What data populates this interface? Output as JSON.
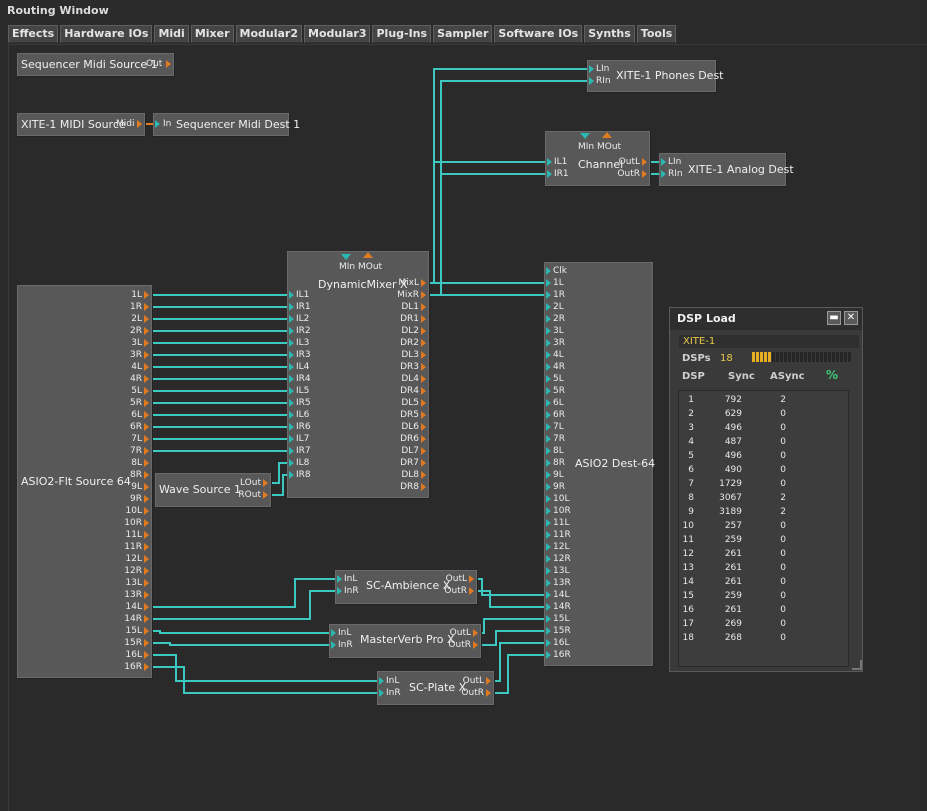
{
  "window": {
    "title": "Routing Window"
  },
  "tabs": [
    "Effects",
    "Hardware IOs",
    "Midi",
    "Mixer",
    "Modular2",
    "Modular3",
    "Plug-Ins",
    "Sampler",
    "Software IOs",
    "Synths",
    "Tools"
  ],
  "modules": {
    "seq_midi_source": {
      "name": "Sequencer Midi Source 1",
      "out": "Out"
    },
    "xite_midi_source": {
      "name": "XITE-1 MIDI Source",
      "out": "Midi"
    },
    "seq_midi_dest": {
      "name": "Sequencer Midi Dest 1",
      "in": "In"
    },
    "phones": {
      "name": "XITE-1 Phones Dest",
      "inputs": [
        "LIn",
        "RIn"
      ]
    },
    "channel": {
      "name": "Channel",
      "top": "MIn MOut",
      "inputs": [
        "IL1",
        "IR1"
      ],
      "outputs": [
        "OutL",
        "OutR"
      ]
    },
    "analog": {
      "name": "XITE-1 Analog Dest",
      "inputs": [
        "LIn",
        "RIn"
      ]
    },
    "dynamicmixer": {
      "name": "DynamicMixer X",
      "top": "MIn MOut",
      "inputs": [
        "IL1",
        "IR1",
        "IL2",
        "IR2",
        "IL3",
        "IR3",
        "IL4",
        "IR4",
        "IL5",
        "IR5",
        "IL6",
        "IR6",
        "IL7",
        "IR7",
        "IL8",
        "IR8"
      ],
      "outputs": [
        "MixL",
        "MixR",
        "DL1",
        "DR1",
        "DL2",
        "DR2",
        "DL3",
        "DR3",
        "DL4",
        "DR4",
        "DL5",
        "DR5",
        "DL6",
        "DR6",
        "DL7",
        "DR7",
        "DL8",
        "DR8"
      ]
    },
    "asio_src": {
      "name": "ASIO2-Flt Source 64",
      "outputs": [
        "1L",
        "1R",
        "2L",
        "2R",
        "3L",
        "3R",
        "4L",
        "4R",
        "5L",
        "5R",
        "6L",
        "6R",
        "7L",
        "7R",
        "8L",
        "8R",
        "9L",
        "9R",
        "10L",
        "10R",
        "11L",
        "11R",
        "12L",
        "12R",
        "13L",
        "13R",
        "14L",
        "14R",
        "15L",
        "15R",
        "16L",
        "16R"
      ]
    },
    "asio_dest": {
      "name": "ASIO2 Dest-64",
      "inputs": [
        "Clk",
        "1L",
        "1R",
        "2L",
        "2R",
        "3L",
        "3R",
        "4L",
        "4R",
        "5L",
        "5R",
        "6L",
        "6R",
        "7L",
        "7R",
        "8L",
        "8R",
        "9L",
        "9R",
        "10L",
        "10R",
        "11L",
        "11R",
        "12L",
        "12R",
        "13L",
        "13R",
        "14L",
        "14R",
        "15L",
        "15R",
        "16L",
        "16R"
      ]
    },
    "wave": {
      "name": "Wave Source 1",
      "outputs": [
        "LOut",
        "ROut"
      ]
    },
    "ambience": {
      "name": "SC-Ambience X",
      "inputs": [
        "InL",
        "InR"
      ],
      "outputs": [
        "OutL",
        "OutR"
      ]
    },
    "masterverb": {
      "name": "MasterVerb Pro X",
      "inputs": [
        "InL",
        "InR"
      ],
      "outputs": [
        "OutL",
        "OutR"
      ]
    },
    "plate": {
      "name": "SC-Plate X",
      "inputs": [
        "InL",
        "InR"
      ],
      "outputs": [
        "OutL",
        "OutR"
      ]
    }
  },
  "dsp": {
    "title": "DSP Load",
    "device": "XITE-1",
    "dsps_label": "DSPs",
    "dsps_value": "18",
    "cols": [
      "DSP",
      "Sync",
      "ASync"
    ],
    "meter_fill": 0.2,
    "rows": [
      [
        "1",
        "792",
        "2"
      ],
      [
        "2",
        "629",
        "0"
      ],
      [
        "3",
        "496",
        "0"
      ],
      [
        "4",
        "487",
        "0"
      ],
      [
        "5",
        "496",
        "0"
      ],
      [
        "6",
        "490",
        "0"
      ],
      [
        "7",
        "1729",
        "0"
      ],
      [
        "8",
        "3067",
        "2"
      ],
      [
        "9",
        "3189",
        "2"
      ],
      [
        "10",
        "257",
        "0"
      ],
      [
        "11",
        "259",
        "0"
      ],
      [
        "12",
        "261",
        "0"
      ],
      [
        "13",
        "261",
        "0"
      ],
      [
        "14",
        "261",
        "0"
      ],
      [
        "15",
        "259",
        "0"
      ],
      [
        "16",
        "261",
        "0"
      ],
      [
        "17",
        "269",
        "0"
      ],
      [
        "18",
        "268",
        "0"
      ]
    ]
  },
  "colors": {
    "wire": "#3cc8c0",
    "port_out": "#e07a20",
    "port_in": "#2bb8b0",
    "meter_on": "#e8b020"
  }
}
